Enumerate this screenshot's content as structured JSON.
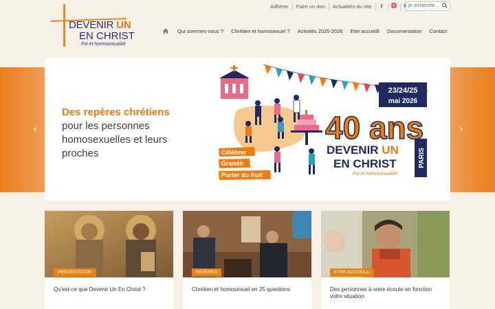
{
  "logo": {
    "line1_plain": "DEVENIR ",
    "line1_accent": "UN",
    "line2": "EN CHRIST",
    "tagline": "Foi et homosexualité"
  },
  "toplinks": [
    "Adhérer",
    "Faire un don",
    "Actualités du site"
  ],
  "social": [
    {
      "name": "facebook-icon",
      "glyph": "f"
    },
    {
      "name": "instagram-icon",
      "glyph": "◘"
    },
    {
      "name": "skype-icon",
      "glyph": "◉"
    }
  ],
  "search": {
    "placeholder": "je recherche..."
  },
  "nav": [
    "Qui sommes-nous ?",
    "Chrétien et homosexuel ?",
    "Activités 2025-2026",
    "Etre accueilli",
    "Documentation",
    "Contact"
  ],
  "hero": {
    "accent": "Des repères chrétiens",
    "plain": "pour les personnes homosexuelles et leurs proches",
    "prev_arrow": "‹",
    "next_arrow": "›"
  },
  "poster": {
    "dates": "23/24/25",
    "month": "mai 2026",
    "big": "40 ans",
    "org_line1_plain": "DEVENIR ",
    "org_line1_accent": "UN",
    "org_line2": "EN CHRIST",
    "tagline": "Foi et homosexualité",
    "city": "PARIS",
    "tags": [
      "Célébrer",
      "Grandir",
      "Porter du fruit"
    ]
  },
  "cards": [
    {
      "badge": "PRÉSENTATION",
      "title": "Qu'est-ce que Devenir Un En Christ ?"
    },
    {
      "badge": "REPÈRES",
      "title": "Chrétien et homosexuel en 25 questions"
    },
    {
      "badge": "ETRE ACCUEILLI",
      "title": "Des personnes à votre écoute en fonction votre situation"
    }
  ],
  "colors": {
    "accent": "#e8830e",
    "navy": "#2d2d6b",
    "background": "#f6f0e6"
  }
}
